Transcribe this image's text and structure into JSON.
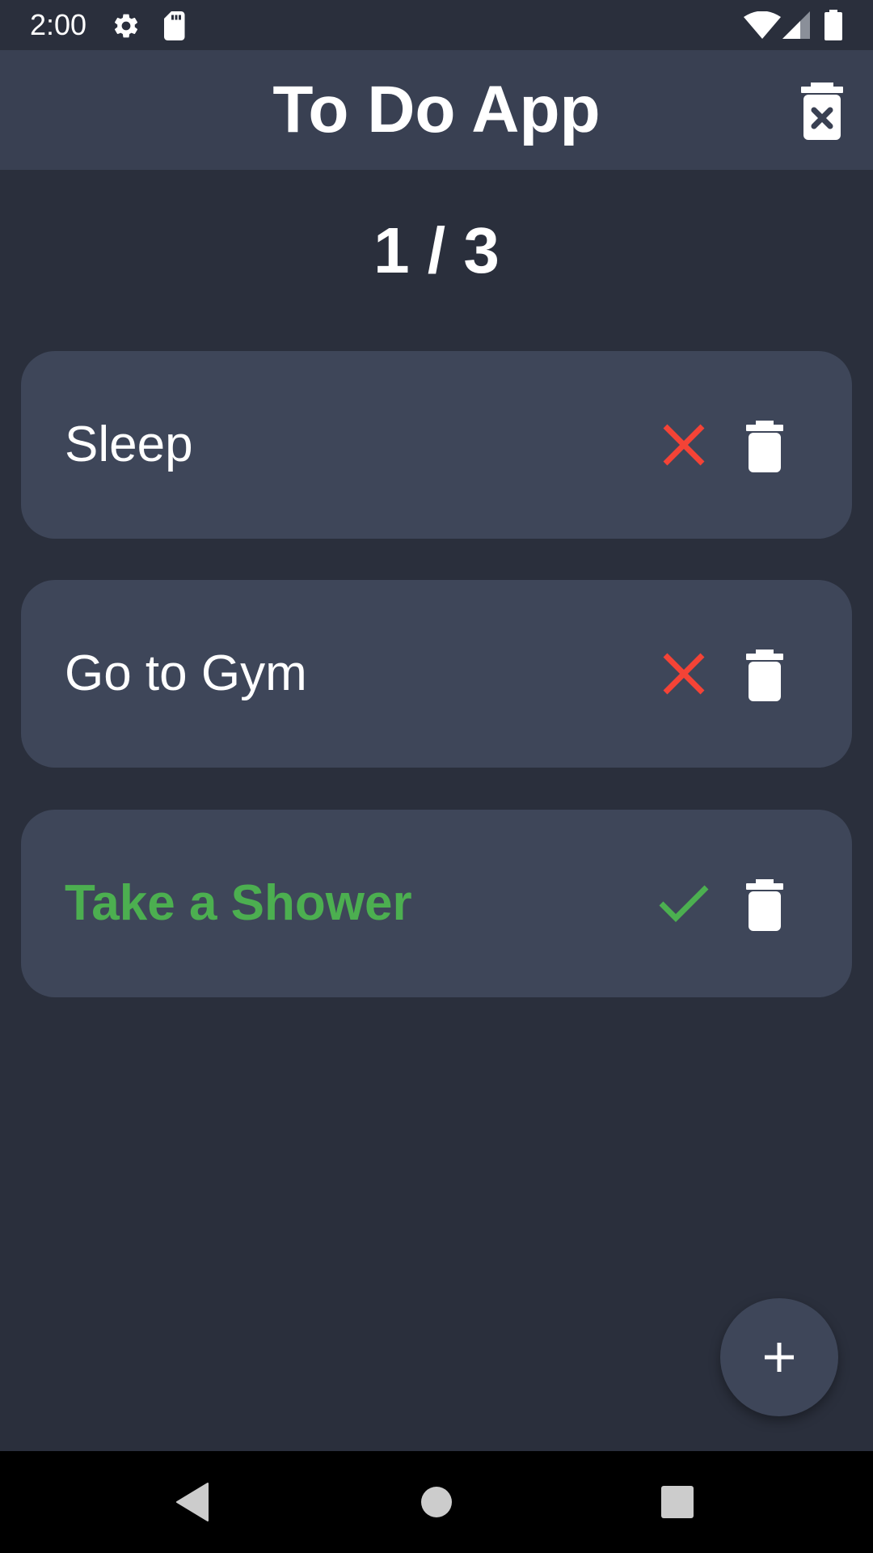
{
  "status_bar": {
    "time": "2:00",
    "icons": [
      "settings-icon",
      "sd-card-icon",
      "wifi-icon",
      "signal-icon",
      "battery-icon"
    ]
  },
  "app_bar": {
    "title": "To Do App",
    "clear_all_icon": "delete-sweep-icon"
  },
  "counter": {
    "text": "1 / 3",
    "completed": 1,
    "total": 3
  },
  "tasks": [
    {
      "title": "Sleep",
      "done": false,
      "status_icon": "close-icon",
      "delete_icon": "trash-icon"
    },
    {
      "title": "Go to Gym",
      "done": false,
      "status_icon": "close-icon",
      "delete_icon": "trash-icon"
    },
    {
      "title": "Take a Shower",
      "done": true,
      "status_icon": "check-icon",
      "delete_icon": "trash-icon"
    }
  ],
  "fab": {
    "icon": "plus-icon"
  },
  "nav_bar": {
    "buttons": [
      "back-icon",
      "home-icon",
      "recents-icon"
    ]
  },
  "colors": {
    "background": "#2a2f3c",
    "app_bar": "#394052",
    "card": "#3e4659",
    "done_green": "#4caf50",
    "not_done_red": "#f44336",
    "text": "#ffffff"
  }
}
